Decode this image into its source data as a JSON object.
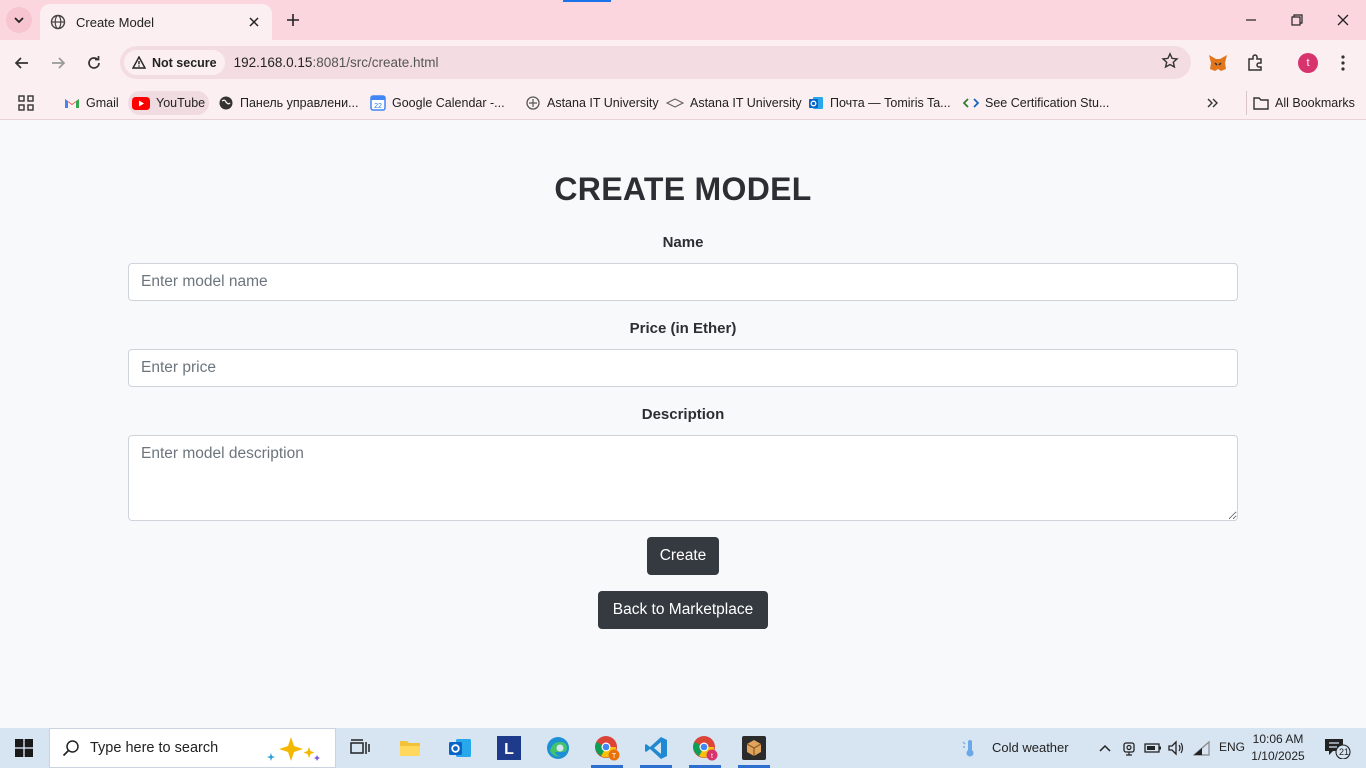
{
  "browser": {
    "tab_title": "Create Model",
    "security_label": "Not secure",
    "url_host": "192.168.0.15",
    "url_rest": ":8081/src/create.html",
    "profile_initial": "t"
  },
  "bookmarks": {
    "items": [
      {
        "label": "Gmail",
        "icon": "gmail-icon"
      },
      {
        "label": "YouTube",
        "icon": "youtube-icon"
      },
      {
        "label": "Панель управлени...",
        "icon": "globe-icon"
      },
      {
        "label": "Google Calendar -...",
        "icon": "calendar-icon"
      },
      {
        "label": "Astana IT University",
        "icon": "university-icon"
      },
      {
        "label": "Astana IT University",
        "icon": "university-icon"
      },
      {
        "label": "Почта — Tomiris Ta...",
        "icon": "outlook-icon"
      },
      {
        "label": "See Certification Stu...",
        "icon": "code-icon"
      }
    ],
    "all_bookmarks": "All Bookmarks"
  },
  "form": {
    "title": "CREATE MODEL",
    "name_label": "Name",
    "name_placeholder": "Enter model name",
    "price_label": "Price (in Ether)",
    "price_placeholder": "Enter price",
    "description_label": "Description",
    "description_placeholder": "Enter model description",
    "create_button": "Create",
    "back_button": "Back to Marketplace"
  },
  "taskbar": {
    "search_placeholder": "Type here to search",
    "weather": "Cold weather",
    "language": "ENG",
    "time": "10:06 AM",
    "date": "1/10/2025",
    "notification_count": "21"
  },
  "colors": {
    "tab_strip": "#fcd6de",
    "button_dark": "#343a40",
    "page_bg": "#f8f9fa",
    "taskbar": "#d7e4f2"
  }
}
